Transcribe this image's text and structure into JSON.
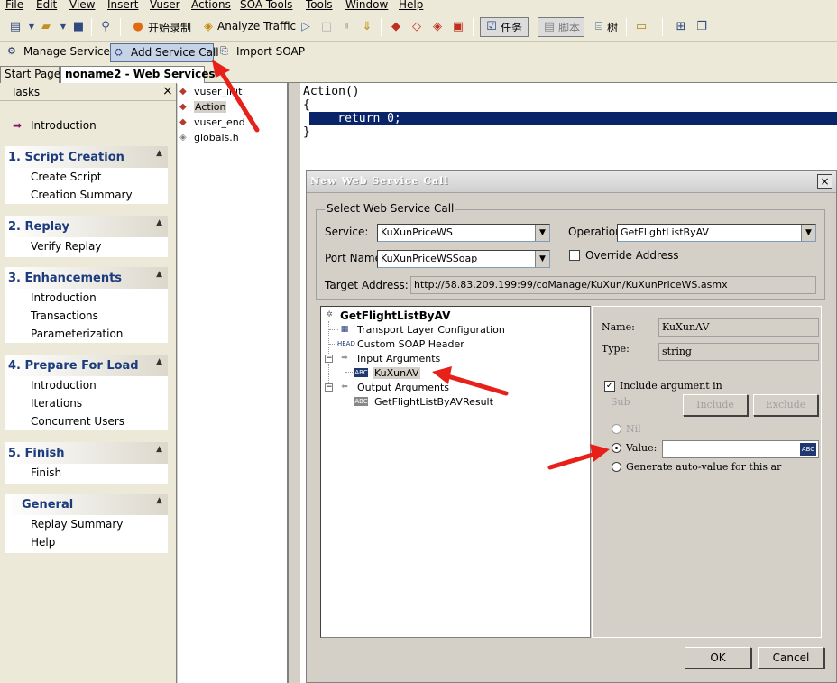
{
  "menubar": {
    "items": [
      "File",
      "Edit",
      "View",
      "Insert",
      "Vuser",
      "Actions",
      "SOA Tools",
      "Tools",
      "Window",
      "Help"
    ]
  },
  "toolbar1": {
    "start_record_label": "开始录制",
    "analyze_traffic_label": "Analyze Traffic",
    "tasks_label": "任务",
    "script_label": "脚本",
    "tree_label": "树"
  },
  "toolbar2": {
    "manage_services": "Manage Services",
    "add_service_call": "Add Service Call",
    "import_soap": "Import SOAP"
  },
  "tabs": [
    "Start Page",
    "noname2 - Web Services"
  ],
  "tasks_pane": {
    "title": "Tasks",
    "close": "×",
    "introduction": "Introduction",
    "groups": [
      {
        "title": "1. Script Creation",
        "items": [
          "Create Script",
          "Creation Summary"
        ]
      },
      {
        "title": "2. Replay",
        "items": [
          "Verify Replay"
        ]
      },
      {
        "title": "3. Enhancements",
        "items": [
          "Introduction",
          "Transactions",
          "Parameterization"
        ]
      },
      {
        "title": "4. Prepare For Load",
        "items": [
          "Introduction",
          "Iterations",
          "Concurrent Users"
        ]
      },
      {
        "title": "5. Finish",
        "items": [
          "Finish"
        ]
      },
      {
        "title": "General",
        "items": [
          "Replay Summary",
          "Help"
        ]
      }
    ]
  },
  "script_files": [
    "vuser_init",
    "Action",
    "vuser_end",
    "globals.h"
  ],
  "editor": {
    "lines": [
      "Action()",
      "{",
      "    return 0;",
      "}"
    ]
  },
  "dialog": {
    "title": "New Web Service Call",
    "close": "×",
    "group_title": "Select Web Service Call",
    "service_label": "Service:",
    "service_value": "KuXunPriceWS",
    "operation_label": "Operation:",
    "operation_value": "GetFlightListByAV",
    "port_label": "Port Name:",
    "port_value": "KuXunPriceWSSoap",
    "override_label": "Override Address",
    "target_label": "Target Address:",
    "target_value": "http://58.83.209.199:99/coManage/KuXun/KuXunPriceWS.asmx",
    "tree": {
      "root": "GetFlightListByAV",
      "transport": "Transport Layer Configuration",
      "soap_header": "Custom SOAP Header",
      "input_args": "Input Arguments",
      "input_arg_item": "KuXunAV",
      "output_args": "Output Arguments",
      "output_arg_item": "GetFlightListByAVResult"
    },
    "details": {
      "name_label": "Name:",
      "name_value": "KuXunAV",
      "type_label": "Type:",
      "type_value": "string",
      "include_label": "Include argument in",
      "sub_label": "Sub",
      "include_btn": "Include",
      "exclude_btn": "Exclude",
      "nil_label": "Nil",
      "value_label": "Value:",
      "value_value": "",
      "auto_label": "Generate auto-value for this ar"
    },
    "ok": "OK",
    "cancel": "Cancel"
  },
  "icons": {
    "toolbar": [
      "new-script-icon",
      "open-icon",
      "save-icon",
      "find-icon",
      "record-icon",
      "analyze-icon",
      "play-icon",
      "stop-icon",
      "pause-icon",
      "compile-icon",
      "breakpoint-icon",
      "run-icon",
      "tasks-icon",
      "script-view-icon",
      "tree-view-icon"
    ],
    "annotation_color": "#e8201a",
    "selection_color": "#0a246a",
    "task_title_color": "#1c3b7c"
  }
}
